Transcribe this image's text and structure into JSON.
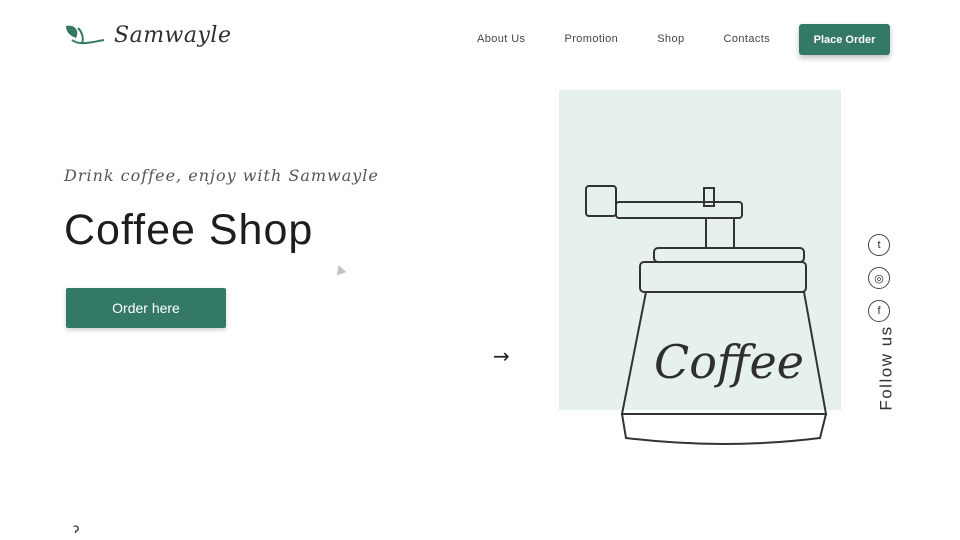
{
  "brand": {
    "name": "Samwayle"
  },
  "nav": {
    "items": [
      "About Us",
      "Promotion",
      "Shop",
      "Contacts"
    ],
    "cta": "Place Order"
  },
  "hero": {
    "tagline": "Drink coffee, enjoy with Samwayle",
    "title": "Coffee Shop",
    "button": "Order here",
    "art_text": "Coffee",
    "next_arrow": "→"
  },
  "social": {
    "label": "Follow us",
    "items": [
      "twitter",
      "instagram",
      "facebook"
    ]
  },
  "footer": {
    "scroll_icon": "ɂ"
  },
  "colors": {
    "accent": "#347866",
    "panel": "#e6f1ec"
  }
}
